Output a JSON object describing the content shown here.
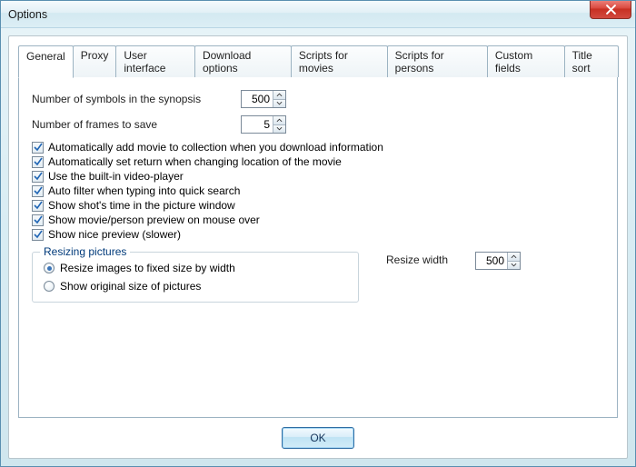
{
  "window": {
    "title": "Options"
  },
  "tabs": [
    {
      "label": "General"
    },
    {
      "label": "Proxy"
    },
    {
      "label": "User interface"
    },
    {
      "label": "Download options"
    },
    {
      "label": "Scripts for movies"
    },
    {
      "label": "Scripts for persons"
    },
    {
      "label": "Custom fields"
    },
    {
      "label": "Title sort"
    }
  ],
  "general": {
    "synopsis_label": "Number of symbols in the synopsis",
    "synopsis_value": "500",
    "frames_label": "Number of frames to save",
    "frames_value": "5",
    "checks": [
      "Automatically add movie to collection when you download information",
      "Automatically set return when changing location of the movie",
      "Use the built-in video-player",
      "Auto filter when typing into quick search",
      "Show shot's time in the picture window",
      "Show movie/person preview on mouse over",
      "Show nice preview (slower)"
    ],
    "resize_group_title": "Resizing pictures",
    "resize_radio_fixed": "Resize images to fixed size by width",
    "resize_radio_orig": "Show original size of pictures",
    "resize_width_label": "Resize width",
    "resize_width_value": "500"
  },
  "footer": {
    "ok": "OK"
  }
}
